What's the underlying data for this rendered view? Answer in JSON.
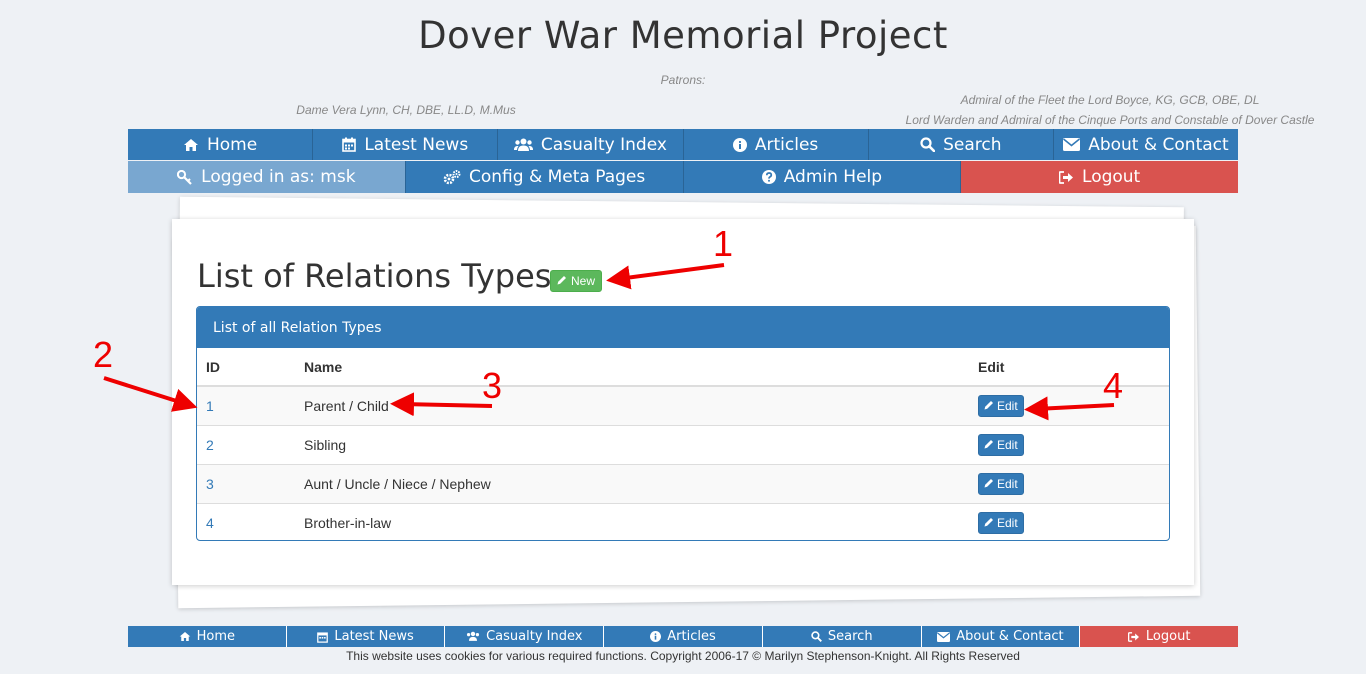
{
  "site": {
    "title": "Dover War Memorial Project",
    "patrons_label": "Patrons:",
    "patron_left": "Dame Vera Lynn, CH, DBE, LL.D, M.Mus",
    "patron_right_1": "Admiral of the Fleet the Lord Boyce, KG, GCB, OBE, DL",
    "patron_right_2": "Lord Warden and Admiral of the Cinque Ports and Constable of Dover Castle"
  },
  "nav": {
    "home": "Home",
    "latest_news": "Latest News",
    "casualty_index": "Casualty Index",
    "articles": "Articles",
    "search": "Search",
    "about_contact": "About & Contact"
  },
  "admin_nav": {
    "logged_in": "Logged in as: msk",
    "config": "Config & Meta Pages",
    "help": "Admin Help",
    "logout": "Logout"
  },
  "page": {
    "title": "List of Relations Types",
    "new_label": "New"
  },
  "panel": {
    "heading": "List of all Relation Types",
    "columns": {
      "id": "ID",
      "name": "Name",
      "edit": "Edit"
    },
    "rows": [
      {
        "id": "1",
        "name": "Parent / Child",
        "edit": "Edit"
      },
      {
        "id": "2",
        "name": "Sibling",
        "edit": "Edit"
      },
      {
        "id": "3",
        "name": "Aunt / Uncle / Niece / Nephew",
        "edit": "Edit"
      },
      {
        "id": "4",
        "name": "Brother-in-law",
        "edit": "Edit"
      }
    ]
  },
  "annotations": {
    "a1": "1",
    "a2": "2",
    "a3": "3",
    "a4": "4"
  },
  "footer": {
    "nav": {
      "home": "Home",
      "latest_news": "Latest News",
      "casualty_index": "Casualty Index",
      "articles": "Articles",
      "search": "Search",
      "about_contact": "About & Contact",
      "logout": "Logout"
    },
    "copyright": "This website uses cookies for various required functions. Copyright 2006-17 © Marilyn Stephenson-Knight. All Rights Reserved"
  },
  "colors": {
    "primary": "#337ab7",
    "danger": "#d9534f",
    "success": "#5cb85c",
    "annotation": "#ee0000"
  }
}
